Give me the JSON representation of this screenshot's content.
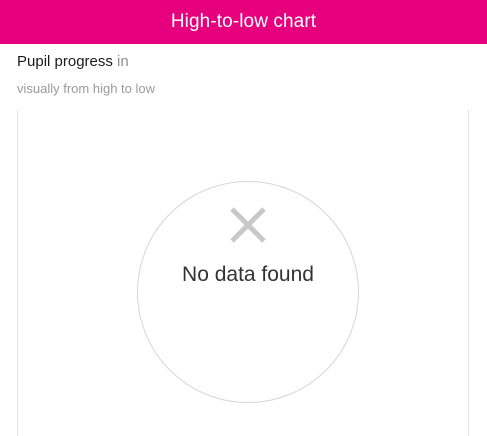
{
  "panel": {
    "title": "High-to-low chart",
    "accent_color": "#e6007e"
  },
  "subheader": {
    "subtitle_strong": "Pupil progress",
    "subtitle_rest": " in",
    "description": "visually from high to low"
  },
  "chart": {
    "empty_icon": "close-icon",
    "empty_message": "No data found"
  }
}
